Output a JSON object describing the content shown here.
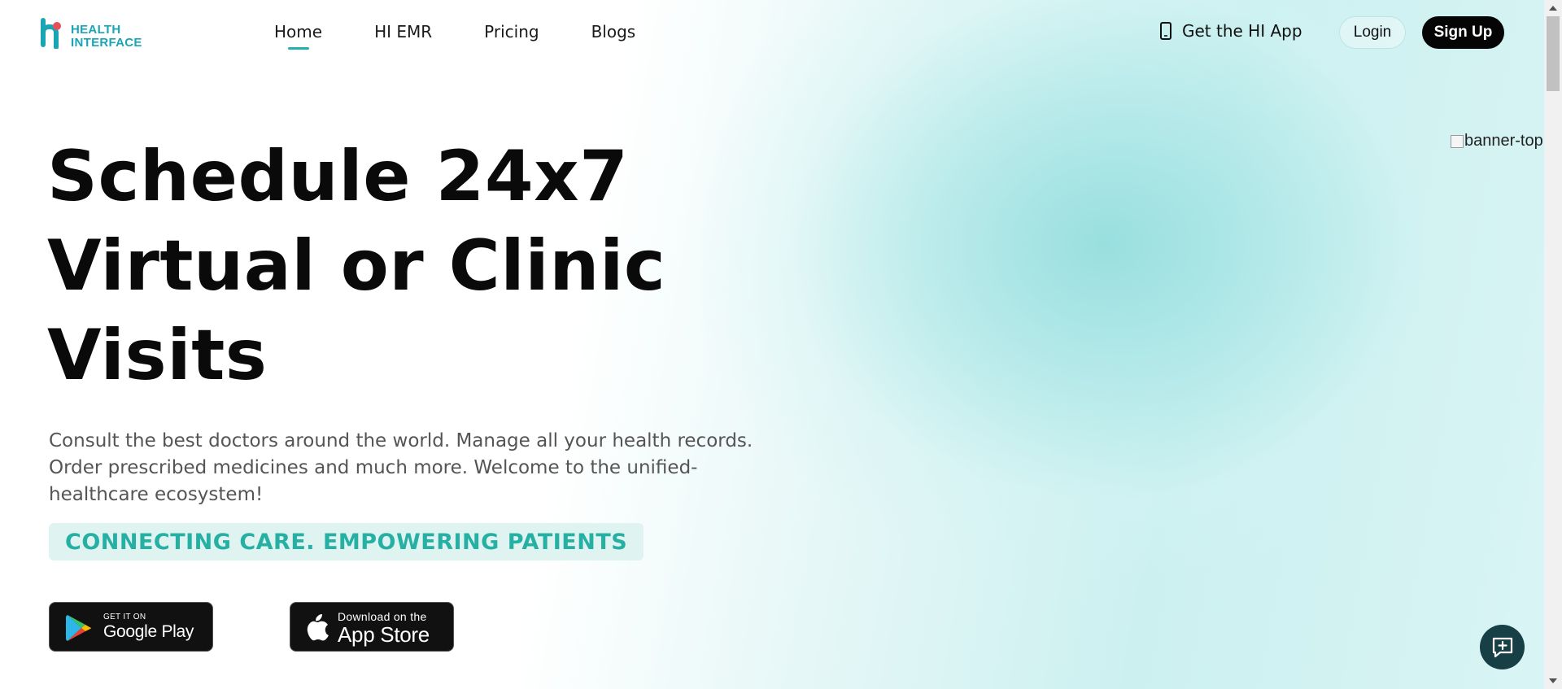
{
  "brand": {
    "line1": "HEALTH",
    "line2": "INTERFACE",
    "accent": "#1aa5b5",
    "dot_color": "#e94e5b"
  },
  "nav": {
    "items": [
      {
        "label": "Home",
        "active": true
      },
      {
        "label": "HI EMR",
        "active": false
      },
      {
        "label": "Pricing",
        "active": false
      },
      {
        "label": "Blogs",
        "active": false
      }
    ]
  },
  "header": {
    "get_app_label": "Get the HI App",
    "get_app_icon": "mobile-phone-icon",
    "login_label": "Login",
    "signup_label": "Sign Up"
  },
  "hero": {
    "title_lines": [
      "Schedule 24x7",
      "Virtual or Clinic",
      "Visits"
    ],
    "description": "Consult the best doctors around the world. Manage all your health records. Order prescribed medicines and much more. Welcome to the unified-healthcare ecosystem!",
    "tagline": "CONNECTING CARE. EMPOWERING PATIENTS",
    "tagline_color": "#26b0a4",
    "banner_alt": "banner-top"
  },
  "stores": {
    "google": {
      "small": "GET IT ON",
      "big": "Google Play",
      "icon": "google-play-icon"
    },
    "apple": {
      "small": "Download on the",
      "big": "App Store",
      "icon": "apple-icon"
    }
  },
  "chat": {
    "icon": "chat-plus-icon",
    "color": "#173f46"
  }
}
